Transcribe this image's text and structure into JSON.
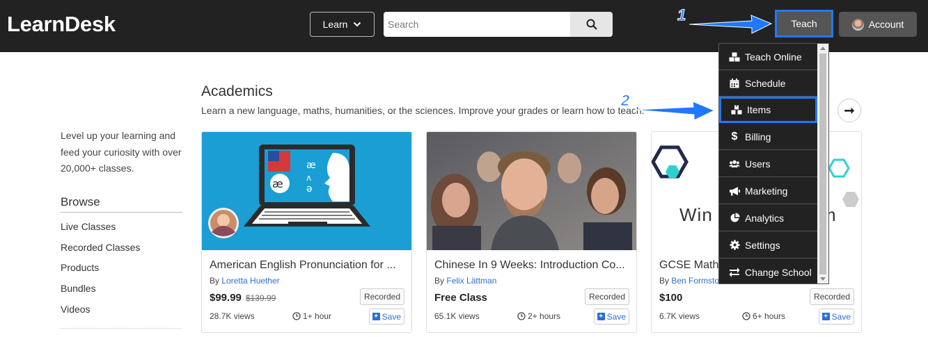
{
  "header": {
    "logo": "LearnDesk",
    "learn_label": "Learn",
    "search_placeholder": "Search",
    "teach_label": "Teach",
    "account_label": "Account"
  },
  "sidebar": {
    "blurb": "Level up your learning and feed your curiosity with over 20,000+ classes.",
    "browse_title": "Browse",
    "items": [
      "Live Classes",
      "Recorded Classes",
      "Products",
      "Bundles",
      "Videos"
    ]
  },
  "section": {
    "title": "Academics",
    "description": "Learn a new language, maths, humanities, or the sciences. Improve your grades or learn how to teach."
  },
  "cards": [
    {
      "title": "American English Pronunciation for ...",
      "by": "By",
      "author": "Loretta Huether",
      "price": "$99.99",
      "old_price": "$139.99",
      "tag": "Recorded",
      "views": "28.7K views",
      "duration": "1+ hour",
      "save": "Save"
    },
    {
      "title": "Chinese In 9 Weeks: Introduction Co...",
      "by": "By",
      "author": "Felix Lättman",
      "price": "Free Class",
      "old_price": "",
      "tag": "Recorded",
      "views": "65.1K views",
      "duration": "2+ hours",
      "save": "Save"
    },
    {
      "title": "GCSE Math",
      "by": "By",
      "author": "Ben Formsto",
      "price": "$100",
      "old_price": "",
      "tag": "Recorded",
      "views": "6.7K views",
      "duration": "6+ hours",
      "save": "Save",
      "thumb_text_left": "Win",
      "thumb_text_right": "m"
    }
  ],
  "teach_menu": {
    "items": [
      {
        "label": "Teach Online",
        "icon": "cubes-icon"
      },
      {
        "label": "Schedule",
        "icon": "calendar-icon"
      },
      {
        "label": "Items",
        "icon": "boxes-icon"
      },
      {
        "label": "Billing",
        "icon": "dollar-icon"
      },
      {
        "label": "Users",
        "icon": "users-icon"
      },
      {
        "label": "Marketing",
        "icon": "megaphone-icon"
      },
      {
        "label": "Analytics",
        "icon": "pie-chart-icon"
      },
      {
        "label": "Settings",
        "icon": "gear-icon"
      },
      {
        "label": "Change School",
        "icon": "exchange-icon"
      }
    ]
  },
  "annotations": {
    "step1": "1",
    "step2": "2"
  },
  "colors": {
    "header_bg": "#222222",
    "accent": "#1f78ff",
    "link": "#2a6fd6"
  }
}
